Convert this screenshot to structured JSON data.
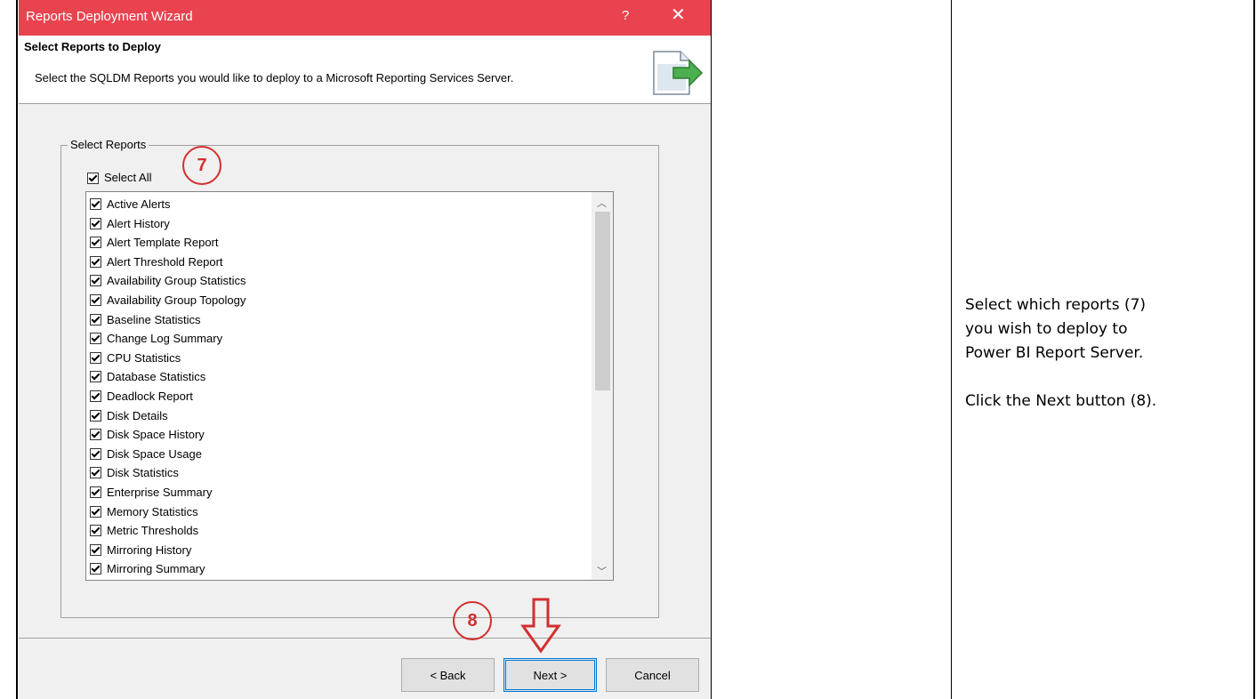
{
  "window": {
    "title": "Reports Deployment Wizard",
    "help_glyph": "?",
    "close_glyph": "✕"
  },
  "header": {
    "heading": "Select Reports to Deploy",
    "description": "Select the SQLDM Reports you would like to deploy to a Microsoft Reporting Services Server.",
    "icon": "deploy-document-arrow-icon"
  },
  "select_reports": {
    "group_label": "Select Reports",
    "select_all_label": "Select All",
    "select_all_checked": true,
    "items": [
      {
        "label": "Active Alerts",
        "checked": true
      },
      {
        "label": "Alert History",
        "checked": true
      },
      {
        "label": "Alert Template Report",
        "checked": true
      },
      {
        "label": "Alert Threshold Report",
        "checked": true
      },
      {
        "label": "Availability Group Statistics",
        "checked": true
      },
      {
        "label": "Availability Group Topology",
        "checked": true
      },
      {
        "label": "Baseline Statistics",
        "checked": true
      },
      {
        "label": "Change Log Summary",
        "checked": true
      },
      {
        "label": "CPU Statistics",
        "checked": true
      },
      {
        "label": "Database Statistics",
        "checked": true
      },
      {
        "label": "Deadlock Report",
        "checked": true
      },
      {
        "label": "Disk Details",
        "checked": true
      },
      {
        "label": "Disk Space History",
        "checked": true
      },
      {
        "label": "Disk Space Usage",
        "checked": true
      },
      {
        "label": "Disk Statistics",
        "checked": true
      },
      {
        "label": "Enterprise Summary",
        "checked": true
      },
      {
        "label": "Memory Statistics",
        "checked": true
      },
      {
        "label": "Metric Thresholds",
        "checked": true
      },
      {
        "label": "Mirroring History",
        "checked": true
      },
      {
        "label": "Mirroring Summary",
        "checked": true
      }
    ]
  },
  "buttons": {
    "back": "< Back",
    "next": "Next >",
    "cancel": "Cancel"
  },
  "annotations": {
    "step7": "7",
    "step8": "8",
    "accent_color": "#d32f2f"
  },
  "instructions": {
    "line1": "Select which reports (7)",
    "line2": "you wish to deploy to",
    "line3": "Power BI Report Server.",
    "line4": "Click the Next button (8)."
  },
  "colors": {
    "titlebar": "#e8434f",
    "dialog_bg": "#f0f0f0"
  }
}
